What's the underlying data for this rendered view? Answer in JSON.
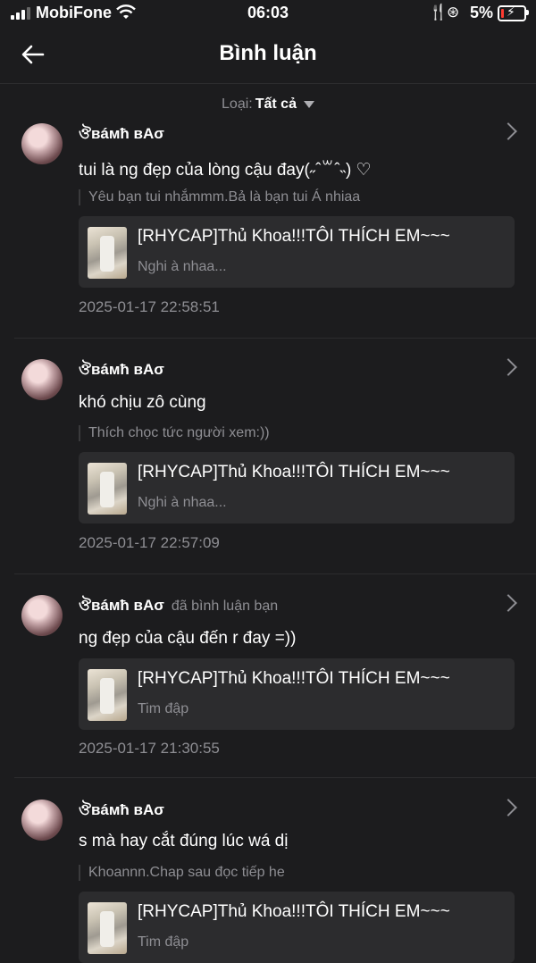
{
  "status": {
    "carrier": "MobiFone",
    "time": "06:03",
    "battery": "5%"
  },
  "header": {
    "title": "Bình luận"
  },
  "filter": {
    "label": "Loại:",
    "value": "Tất cả"
  },
  "comments": [
    {
      "username": "ঔвáмħ вΑσ",
      "action": "",
      "text": "tui là ng đẹp của lòng cậu đay(˶ˆ꒳ˆ˵) ♡",
      "quote": "Yêu bạn tui nhắmmm.Bả là bạn tui Á nhiaa",
      "card_title": "[RHYCAP]Thủ Khoa!!!TÔI THÍCH EM~~~",
      "card_sub": "Nghi à nhaa...",
      "time": "2025-01-17 22:58:51"
    },
    {
      "username": "ঔвáмħ вΑσ",
      "action": "",
      "text": "khó chịu zô cùng",
      "quote": "Thích chọc tức người xem:))",
      "card_title": "[RHYCAP]Thủ Khoa!!!TÔI THÍCH EM~~~",
      "card_sub": "Nghi à nhaa...",
      "time": "2025-01-17 22:57:09"
    },
    {
      "username": "ঔвáмħ вΑσ",
      "action": "đã bình luận bạn",
      "text": "ng đẹp của cậu đến r đay =))",
      "quote": "",
      "card_title": "[RHYCAP]Thủ Khoa!!!TÔI THÍCH EM~~~",
      "card_sub": "Tim đập",
      "time": "2025-01-17 21:30:55"
    },
    {
      "username": "ঔвáмħ вΑσ",
      "action": "",
      "text": "s mà hay cắt đúng lúc wá dị",
      "quote": "Khoannn.Chap sau đọc tiếp he",
      "card_title": "[RHYCAP]Thủ Khoa!!!TÔI THÍCH EM~~~",
      "card_sub": "Tim đập",
      "time": ""
    }
  ]
}
